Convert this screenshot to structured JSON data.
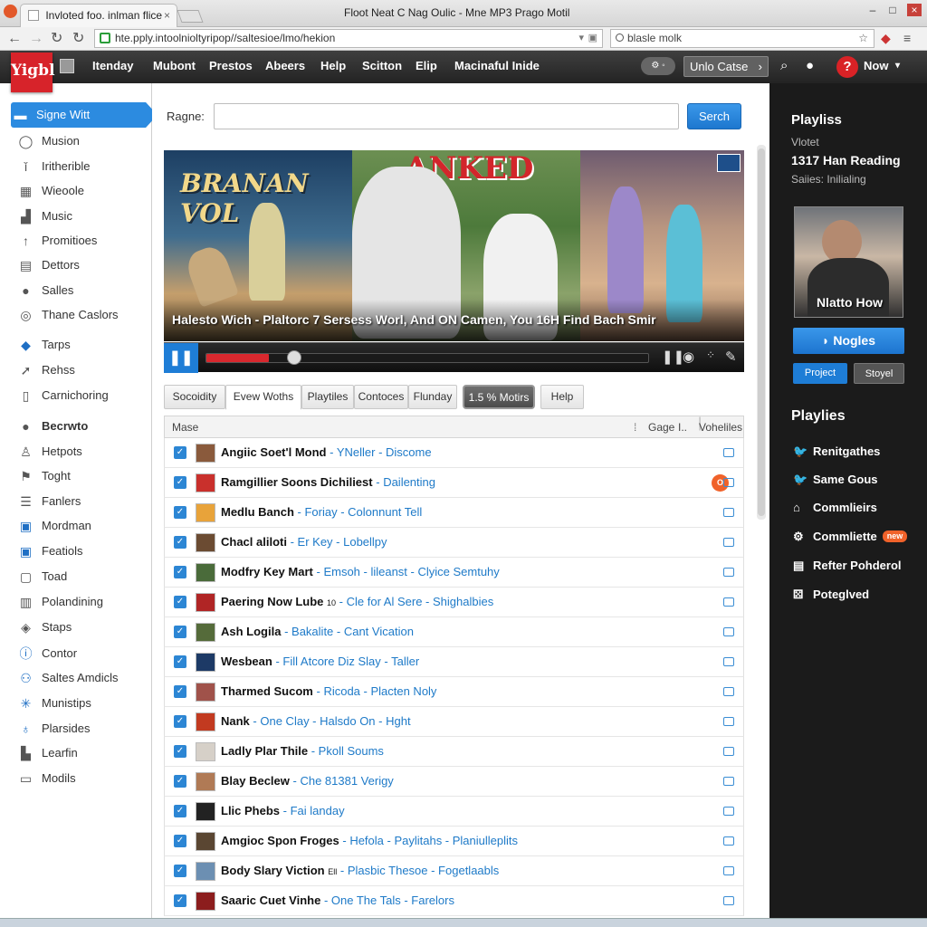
{
  "browser": {
    "tab_title": "Invloted foo. inlman flice",
    "window_title": "Floot Neat C Nag Oulic - Mne MP3 Prago Motil",
    "url": "hte.pply.intoolnioltyripop//saltesioe/lmo/hekion",
    "search_text": "blasle molk"
  },
  "topnav": {
    "logo_text": "Yigbl",
    "items": [
      "Itenday",
      "Mubont",
      "Prestos",
      "Abeers",
      "Help",
      "Scitton",
      "Elip",
      "Macinaful Inide"
    ],
    "dropdown_label": "Unlo Catse",
    "now_label": "Now"
  },
  "sidebar": {
    "items": [
      {
        "label": "Signe Witt",
        "icon": "home-icon"
      },
      {
        "label": "Musion",
        "icon": "music-icon"
      },
      {
        "label": "Iritherible",
        "icon": "person-icon"
      },
      {
        "label": "Wieoole",
        "icon": "grid-icon"
      },
      {
        "label": "Music",
        "icon": "music-note-icon"
      },
      {
        "label": "Promitioes",
        "icon": "pin-icon"
      },
      {
        "label": "Dettors",
        "icon": "document-icon"
      },
      {
        "label": "Salles",
        "icon": "location-icon"
      },
      {
        "label": "Thane Caslors",
        "icon": "circle-icon"
      },
      {
        "label": "Tarps",
        "icon": "diamond-icon"
      },
      {
        "label": "Rehss",
        "icon": "arrow-icon"
      },
      {
        "label": "Carnichoring",
        "icon": "tag-icon"
      },
      {
        "label": "Becrwto",
        "icon": "user-icon"
      },
      {
        "label": "Hetpots",
        "icon": "people-icon"
      },
      {
        "label": "Toght",
        "icon": "flag-icon"
      },
      {
        "label": "Fanlers",
        "icon": "list-icon"
      },
      {
        "label": "Mordman",
        "icon": "video-icon"
      },
      {
        "label": "Featiols",
        "icon": "star-icon"
      },
      {
        "label": "Toad",
        "icon": "box-icon"
      },
      {
        "label": "Polandining",
        "icon": "chart-icon"
      },
      {
        "label": "Staps",
        "icon": "tag-icon"
      },
      {
        "label": "Contor",
        "icon": "info-icon"
      },
      {
        "label": "Saltes Amdicls",
        "icon": "share-icon"
      },
      {
        "label": "Munistips",
        "icon": "sparkle-icon"
      },
      {
        "label": "Plarsides",
        "icon": "pin-icon"
      },
      {
        "label": "Learfin",
        "icon": "book-icon"
      },
      {
        "label": "Modils",
        "icon": "window-icon"
      }
    ]
  },
  "search": {
    "label": "Ragne:",
    "placeholder": "",
    "button": "Serch"
  },
  "banner": {
    "panel1_heading": "BRANAN VOL",
    "panel2_heading": "ANKED",
    "caption": "Halesto Wich - Plaltorc 7 Sersess Worl, And ON Camen, You 16H Find Bach Smir"
  },
  "tabs": [
    "Socoidity",
    "Evew Woths",
    "Playtiles",
    "Contoces",
    "Flunday",
    "1.5 %  Motirs",
    "Help"
  ],
  "table": {
    "headers": [
      "Mase",
      "Gage",
      "I..",
      "Voheliles"
    ],
    "rows": [
      {
        "title": "Angiic Soet'l Mond",
        "sub": "YNeller - Discome",
        "thumb": "#8a5a3c"
      },
      {
        "title": "Ramgillier Soons Dichiliest",
        "sub": "Dailenting",
        "thumb": "#c9302c",
        "badge": "O"
      },
      {
        "title": "Medlu Banch",
        "sub": "Foriay - Colonnunt Tell",
        "thumb": "#e8a33a"
      },
      {
        "title": "Chacl aliloti",
        "sub": "Er Key - Lobellpy",
        "thumb": "#6b4b32"
      },
      {
        "title": "Modfry Key Mart",
        "sub": "Emsoh - lileanst - Clyice Semtuhy",
        "thumb": "#4a6b3a"
      },
      {
        "title": "Paering Now Lube",
        "sub": "Cle for Al Sere - Shighalbies",
        "thumb": "#b02525",
        "tag": "10"
      },
      {
        "title": "Ash Logila",
        "sub": "Bakalite - Cant Vication",
        "thumb": "#556b3a"
      },
      {
        "title": "Wesbean",
        "sub": "Fill Atcore Diz Slay - Taller",
        "thumb": "#1d3a66"
      },
      {
        "title": "Tharmed Sucom",
        "sub": "Ricoda - Placten Noly",
        "thumb": "#a0524a"
      },
      {
        "title": "Nank",
        "sub": "One Clay - Halsdo On - Hght",
        "thumb": "#c23a20"
      },
      {
        "title": "Ladly Plar Thile",
        "sub": "Pkoll Soums",
        "thumb": "#d6d0c8"
      },
      {
        "title": "Blay Beclew",
        "sub": "Che 81381 Verigy",
        "thumb": "#b07a55"
      },
      {
        "title": "Llic Phebs",
        "sub": "Fai landay",
        "thumb": "#222222"
      },
      {
        "title": "Amgioc Spon Froges",
        "sub": "Hefola - Paylitahs - Planiulleplits",
        "thumb": "#5a4632"
      },
      {
        "title": "Body Slary Viction",
        "sub": "Plasbic Thesoe - Fogetlaabls",
        "thumb": "#6c8fb2",
        "tag": "Ell"
      },
      {
        "title": "Saaric Cuet Vinhe",
        "sub": "One The Tals - Farelors",
        "thumb": "#8c1d1d"
      }
    ]
  },
  "rightpanel": {
    "heading": "Playliss",
    "small1": "Vlotet",
    "track": "1317 Han Reading",
    "small2": "Saiies: Inilialing",
    "image_caption": "Nlatto How",
    "big_button": "Nogles",
    "btn_primary": "Project",
    "btn_secondary": "Stoyel",
    "playlists_heading": "Playlies",
    "items": [
      {
        "label": "Renitgathes",
        "icon": "twitter-icon"
      },
      {
        "label": "Same Gous",
        "icon": "twitter-icon"
      },
      {
        "label": "Commlieirs",
        "icon": "home-icon"
      },
      {
        "label": "Commliette",
        "icon": "gear-icon",
        "badge": "new"
      },
      {
        "label": "Refter Pohderol",
        "icon": "document-icon"
      },
      {
        "label": "Poteglved",
        "icon": "share-icon"
      }
    ]
  },
  "colors": {
    "accent": "#2c8be0",
    "brand": "#d7232a",
    "progress": "#d8282e"
  },
  "player": {
    "progress": 0.1
  }
}
